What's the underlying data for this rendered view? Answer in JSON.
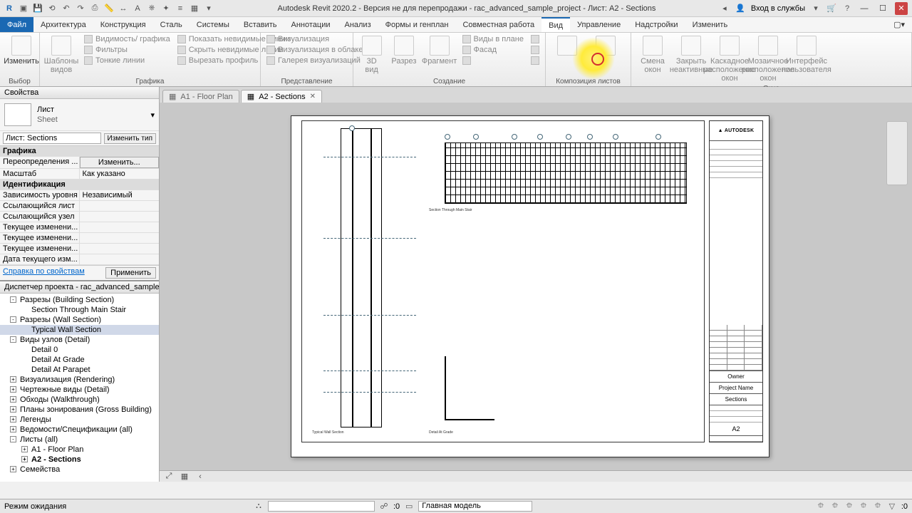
{
  "titlebar": {
    "title": "Autodesk Revit 2020.2 - Версия не для перепродажи - rac_advanced_sample_project - Лист: A2 - Sections",
    "login": "Вход в службы"
  },
  "tabs": {
    "file": "Файл",
    "items": [
      "Архитектура",
      "Конструкция",
      "Сталь",
      "Системы",
      "Вставить",
      "Аннотации",
      "Анализ",
      "Формы и генплан",
      "Совместная работа",
      "Вид",
      "Управление",
      "Надстройки",
      "Изменить"
    ],
    "active_index": 9
  },
  "ribbon": {
    "select": {
      "btn": "Изменить",
      "title": "Выбор"
    },
    "templates": {
      "btn": "Шаблоны\nвидов",
      "title": ""
    },
    "graphics": {
      "title": "Графика",
      "items": [
        "Видимость/ графика",
        "Фильтры",
        "Тонкие линии",
        "Показать невидимые линии",
        "Скрыть невидимые линии",
        "Вырезать профиль",
        "Визуализация",
        "Визуализация в облаке",
        "Галерея визуализаций"
      ]
    },
    "presentation": {
      "title": "Представление"
    },
    "create": {
      "title": "Создание",
      "big": [
        "3D\nвид",
        "Разрез",
        "Фрагмент"
      ],
      "small": [
        "Виды в плане",
        "Фасад"
      ]
    },
    "sheet": {
      "title": "Композиция листов"
    },
    "windows": {
      "title": "Окна",
      "items": [
        "Смена\nокон",
        "Закрыть\nнеактивные",
        "Каскадное\nрасположение окон",
        "Мозаичное\nрасположение окон",
        "Интерфейс\nпользователя"
      ]
    }
  },
  "properties": {
    "header": "Свойства",
    "type_name": "Лист",
    "type_sub": "Sheet",
    "instance": "Лист: Sections",
    "edit_type": "Изменить тип",
    "groups": [
      {
        "cat": "Графика",
        "rows": [
          {
            "k": "Переопределения ...",
            "v": "Изменить...",
            "btn": true
          },
          {
            "k": "Масштаб",
            "v": "Как указано"
          }
        ]
      },
      {
        "cat": "Идентификация",
        "rows": [
          {
            "k": "Зависимость уровня",
            "v": "Независимый"
          },
          {
            "k": "Ссылающийся лист",
            "v": ""
          },
          {
            "k": "Ссылающийся узел",
            "v": ""
          },
          {
            "k": "Текущее изменени...",
            "v": ""
          },
          {
            "k": "Текущее изменени...",
            "v": ""
          },
          {
            "k": "Текущее изменени...",
            "v": ""
          },
          {
            "k": "Дата текущего изм...",
            "v": ""
          }
        ]
      }
    ],
    "help_link": "Справка по свойствам",
    "apply": "Применить"
  },
  "browser": {
    "header": "Диспетчер проекта - rac_advanced_sample_proj...",
    "items": [
      {
        "l": 1,
        "exp": "-",
        "t": "Разрезы (Building Section)"
      },
      {
        "l": 2,
        "t": "Section Through Main Stair"
      },
      {
        "l": 1,
        "exp": "-",
        "t": "Разрезы (Wall Section)"
      },
      {
        "l": 2,
        "t": "Typical Wall Section",
        "sel": true
      },
      {
        "l": 1,
        "exp": "-",
        "t": "Виды узлов (Detail)"
      },
      {
        "l": 2,
        "t": "Detail 0"
      },
      {
        "l": 2,
        "t": "Detail At Grade"
      },
      {
        "l": 2,
        "t": "Detail At Parapet"
      },
      {
        "l": 1,
        "exp": "+",
        "t": "Визуализация (Rendering)"
      },
      {
        "l": 1,
        "exp": "+",
        "t": "Чертежные виды (Detail)"
      },
      {
        "l": 1,
        "exp": "+",
        "t": "Обходы (Walkthrough)"
      },
      {
        "l": 1,
        "exp": "+",
        "t": "Планы зонирования (Gross Building)"
      },
      {
        "l": 1,
        "exp": "+",
        "t": "Легенды"
      },
      {
        "l": 1,
        "exp": "+",
        "t": "Ведомости/Спецификации (all)"
      },
      {
        "l": 1,
        "exp": "-",
        "t": "Листы (all)"
      },
      {
        "l": 2,
        "exp": "+",
        "t": "A1 - Floor Plan"
      },
      {
        "l": 2,
        "exp": "+",
        "t": "A2 - Sections",
        "bold": true
      },
      {
        "l": 1,
        "exp": "+",
        "t": "Семейства"
      }
    ]
  },
  "viewtabs": {
    "inactive": "A1 - Floor Plan",
    "active": "A2 - Sections"
  },
  "titleblock": {
    "logo": "▲ AUTODESK",
    "owner": "Owner",
    "project": "Project Name",
    "sheet_name": "Sections",
    "sheet_num": "A2"
  },
  "drawing_labels": {
    "section_main": "Section Through Main Stair",
    "wall_section": "Typical Wall Section",
    "detail_grade": "Detail At Grade"
  },
  "statusbar": {
    "mode": "Режим ожидания",
    "zero": ":0",
    "model": "Главная модель"
  }
}
